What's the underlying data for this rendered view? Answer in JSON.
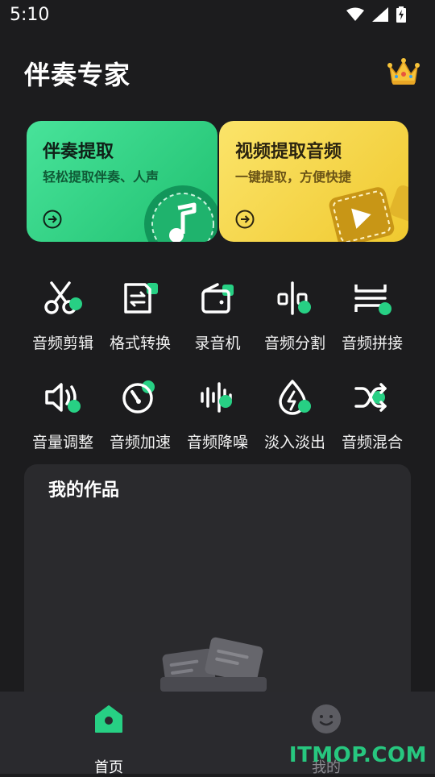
{
  "status": {
    "time": "5:10"
  },
  "header": {
    "title": "伴奏专家"
  },
  "cards": [
    {
      "title": "伴奏提取",
      "subtitle": "轻松提取伴奏、人声"
    },
    {
      "title": "视频提取音频",
      "subtitle": "一键提取，方便快捷"
    }
  ],
  "tools": [
    {
      "label": "音频剪辑",
      "icon": "scissors-icon"
    },
    {
      "label": "格式转换",
      "icon": "format-convert-icon"
    },
    {
      "label": "录音机",
      "icon": "recorder-icon"
    },
    {
      "label": "音频分割",
      "icon": "split-icon"
    },
    {
      "label": "音频拼接",
      "icon": "join-icon"
    },
    {
      "label": "音量调整",
      "icon": "volume-icon"
    },
    {
      "label": "音频加速",
      "icon": "speedometer-icon"
    },
    {
      "label": "音频降噪",
      "icon": "waveform-icon"
    },
    {
      "label": "淡入淡出",
      "icon": "fade-icon"
    },
    {
      "label": "音频混合",
      "icon": "shuffle-icon"
    }
  ],
  "works": {
    "title": "我的作品"
  },
  "nav": [
    {
      "label": "首页"
    },
    {
      "label": "我的"
    }
  ],
  "watermark": "ITMOP.COM",
  "colors": {
    "accent": "#27d084",
    "background": "#1c1c1e",
    "panel": "#2a2a2d"
  }
}
